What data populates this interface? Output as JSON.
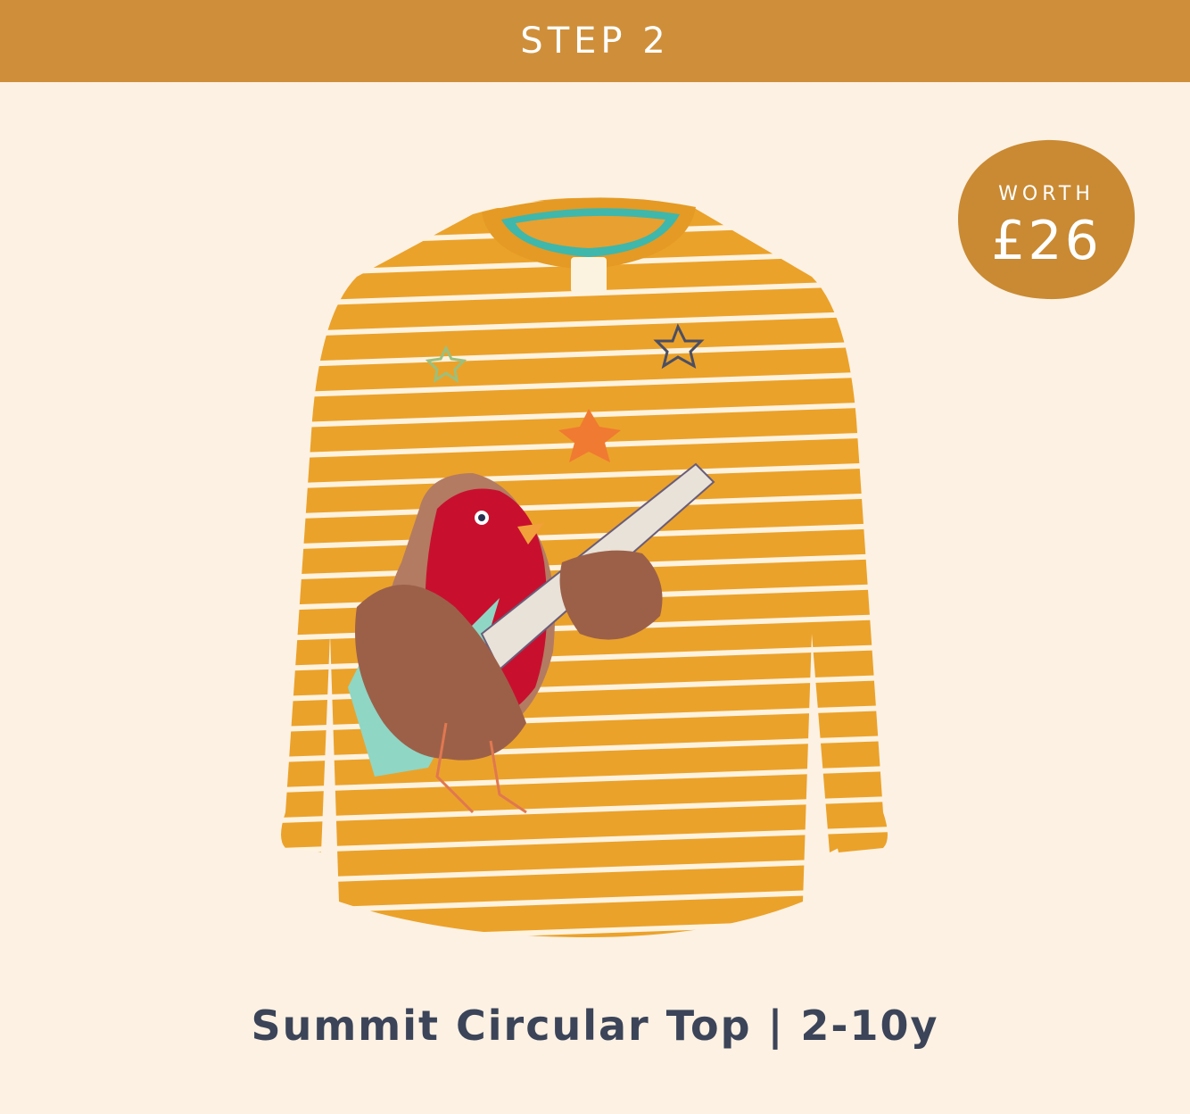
{
  "banner": {
    "label": "STEP 2"
  },
  "badge": {
    "label": "WORTH",
    "price": "£26"
  },
  "product": {
    "title": "Summit Circular Top | 2-10y"
  },
  "colors": {
    "banner": "#cf8f3a",
    "background": "#fcf1e3",
    "badge": "#c98a33",
    "shirt": "#eba22a",
    "stripe": "#fff3df",
    "title": "#3b4458"
  },
  "icons": [
    "product-photo-shirt-icon"
  ]
}
